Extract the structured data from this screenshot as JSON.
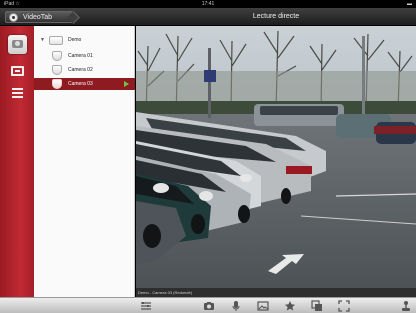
{
  "status_bar": {
    "carrier": "iPad ☆",
    "time": "17:41",
    "battery": "▬"
  },
  "app": {
    "name": "VideoTab",
    "logo_icon": "eye-logo-icon"
  },
  "header": {
    "title": "Lecture directe"
  },
  "rail": {
    "items": [
      {
        "icon": "camera-icon",
        "active": true
      },
      {
        "icon": "monitor-icon",
        "active": false
      },
      {
        "icon": "list-icon",
        "active": false
      }
    ]
  },
  "tree": {
    "root": {
      "label": "Demo",
      "expanded": true
    },
    "cameras": [
      {
        "label": "Camera 01",
        "selected": false
      },
      {
        "label": "Camera 02",
        "selected": false
      },
      {
        "label": "Camera 03",
        "selected": true
      }
    ]
  },
  "video": {
    "caption": "Demo - Camera 03 (Redondé)"
  },
  "toolbar": {
    "icons": [
      "list-settings-icon",
      "camera-snapshot-icon",
      "microphone-icon",
      "image-icon",
      "star-icon",
      "copy-icon",
      "fullscreen-icon",
      "joystick-icon"
    ]
  },
  "colors": {
    "accent": "#b3232b",
    "selected_row": "#8e1b20",
    "play": "#6cc644"
  }
}
